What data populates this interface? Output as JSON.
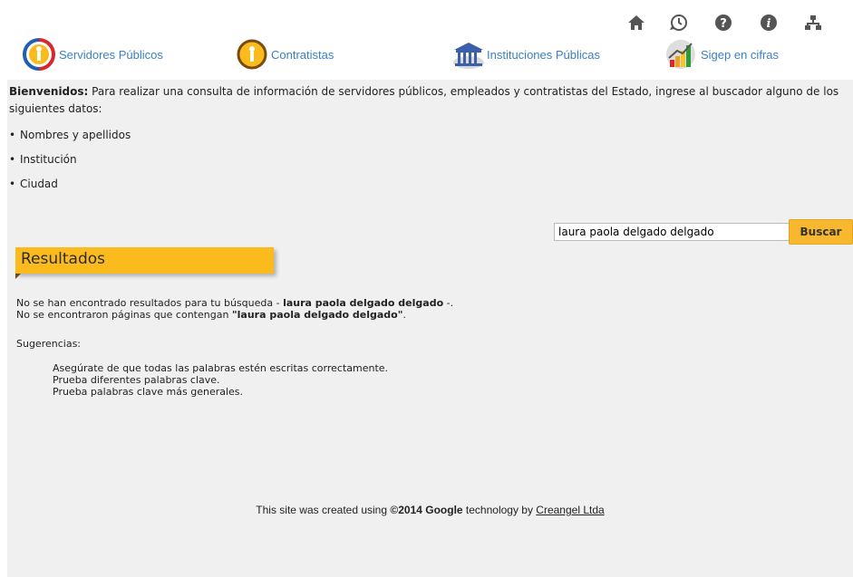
{
  "top_icons": [
    "home-icon",
    "history-icon",
    "help-icon",
    "info-icon",
    "sitemap-icon"
  ],
  "nav": {
    "servidores": "Servidores Públicos",
    "contratistas": "Contratistas",
    "instituciones": "Instituciones Públicas",
    "cifras": "Sigep en cifras"
  },
  "intro": {
    "bold": "Bienvenidos:",
    "text": " Para realizar una consulta de información de servidores públicos, empleados y contratistas del Estado, ingrese al buscador alguno de los siguientes datos:",
    "bullets": [
      "Nombres y apellidos",
      "Institución",
      "Ciudad"
    ]
  },
  "search": {
    "value": "laura paola delgado delgado",
    "button": "Buscar"
  },
  "results": {
    "heading": "Resultados",
    "line1_prefix": "No se han encontrado resultados para tu búsqueda - ",
    "line1_query": "laura paola delgado delgado",
    "line1_suffix": " -.",
    "line2_prefix": "No se encontraron páginas que contengan ",
    "line2_query": "\"laura paola delgado delgado\"",
    "line2_suffix": ".",
    "suggestions_label": "Sugerencias:",
    "suggestions": [
      "Asegúrate de que todas las palabras estén escritas correctamente.",
      "Prueba diferentes palabras clave.",
      "Prueba palabras clave más generales."
    ]
  },
  "footer": {
    "prefix": "This site was created using ",
    "bold": "©2014 Google",
    "middle": " technology by ",
    "link": "Creangel Ltda"
  },
  "colors": {
    "accent": "#fbbb1c",
    "link": "#3b7fc4",
    "background": "#f0f0f0"
  }
}
